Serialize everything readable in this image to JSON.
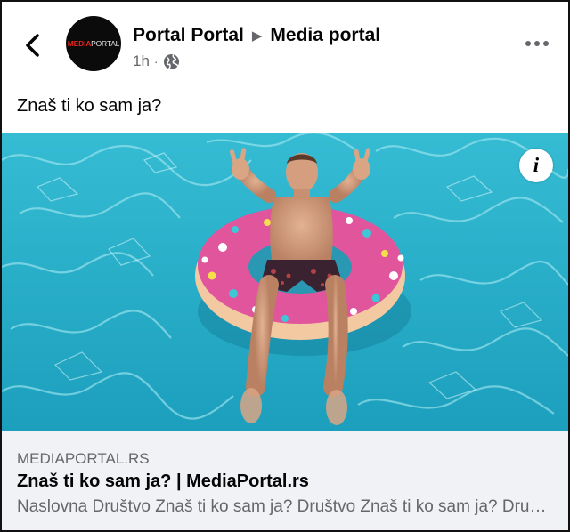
{
  "header": {
    "back_label": "back",
    "avatar_logo_red": "MEDIA",
    "avatar_logo_light": "PORTAL",
    "author": "Portal Portal",
    "destination": "Media portal",
    "time": "1h",
    "dot": "·",
    "privacy_icon": "globe-icon",
    "more_icon": "more-horizontal-icon"
  },
  "post": {
    "caption": "Znaš ti ko sam ja?"
  },
  "photo": {
    "info_label": "i",
    "water_color": "#21a9c4",
    "float_color": "#e0559c"
  },
  "link_preview": {
    "domain": "MEDIAPORTAL.RS",
    "title": "Znaš ti ko sam ja? | MediaPortal.rs",
    "description": "Naslovna Društvo Znaš ti ko sam ja? Društvo Znaš ti ko sam ja? Društvo Znaš ti ko sam ja?"
  }
}
